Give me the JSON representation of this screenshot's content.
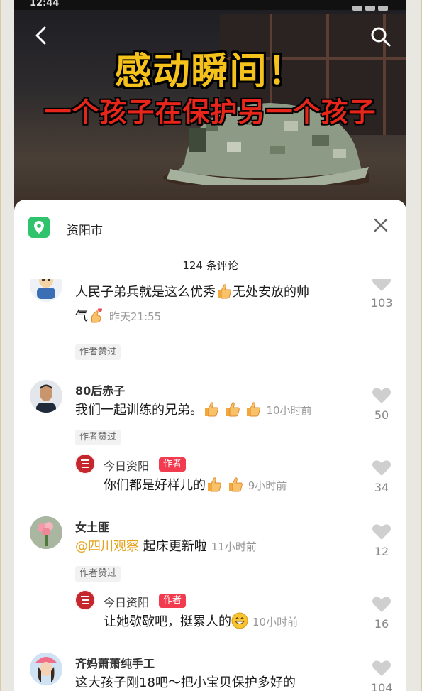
{
  "status_bar": {
    "time": "12:44"
  },
  "video": {
    "headline_line1": "感动瞬间！",
    "headline_line2": "一个孩子在保护另一个孩子"
  },
  "sheet": {
    "location": "资阳市",
    "comment_count": "124 条评论"
  },
  "icons": {
    "back": "back-arrow-icon",
    "search": "search-icon",
    "location": "location-pin-icon",
    "close": "close-icon",
    "like": "heart-icon",
    "thumbs_up": "thumbs-up-emoji",
    "finger_heart": "finger-heart-emoji",
    "grin": "grin-emoji"
  },
  "colors": {
    "headline_yellow": "#f5c21b",
    "headline_red": "#e8251b",
    "location_green": "#2fc36b",
    "author_badge": "#f23b4f",
    "mention": "#e3a21a"
  },
  "comments": [
    {
      "text_part1": "人民子弟兵就是这么优秀",
      "text_part2": "无处安放的帅",
      "text_line2": "气",
      "time": "昨天21:55",
      "liked_by_author": "作者赞过",
      "likes": "103"
    },
    {
      "user": "80后赤子",
      "text": "我们一起训练的兄弟。",
      "time": "10小时前",
      "liked_by_author": "作者赞过",
      "likes": "50",
      "reply": {
        "user": "今日资阳",
        "badge": "作者",
        "text": "你们都是好样儿的",
        "time": "9小时前",
        "likes": "34"
      }
    },
    {
      "user": "女土匪",
      "mention": "@四川观察",
      "text": "起床更新啦",
      "time": "11小时前",
      "liked_by_author": "作者赞过",
      "likes": "12",
      "reply": {
        "user": "今日资阳",
        "badge": "作者",
        "text": "让她歇歇吧，挺累人的",
        "time": "10小时前",
        "likes": "16"
      }
    },
    {
      "user": "齐妈萧萧纯手工",
      "text": "这大孩子刚18吧～把小宝贝保护多好的",
      "likes": "104"
    }
  ]
}
